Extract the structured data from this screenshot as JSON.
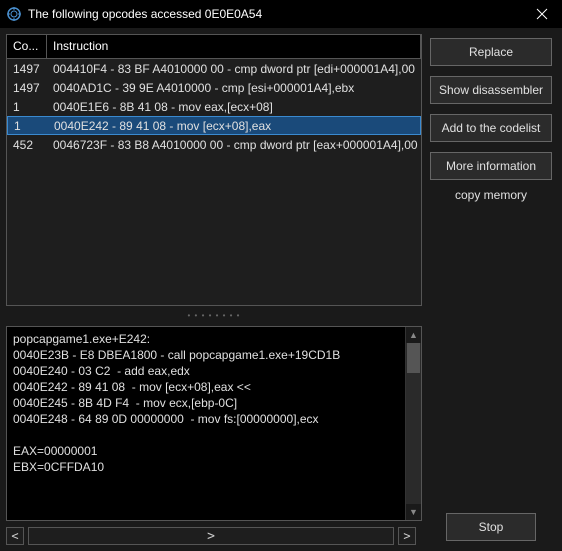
{
  "titlebar": {
    "title": "The following opcodes accessed 0E0E0A54"
  },
  "table": {
    "headers": {
      "count": "Co...",
      "instruction": "Instruction"
    },
    "rows": [
      {
        "count": "1497",
        "instr": "004410F4 - 83 BF A4010000 00 - cmp dword ptr [edi+000001A4],00",
        "selected": false
      },
      {
        "count": "1497",
        "instr": "0040AD1C - 39 9E A4010000  - cmp [esi+000001A4],ebx",
        "selected": false
      },
      {
        "count": "1",
        "instr": "0040E1E6 - 8B 41 08  - mov eax,[ecx+08]",
        "selected": false
      },
      {
        "count": "1",
        "instr": "0040E242 - 89 41 08  - mov [ecx+08],eax",
        "selected": true
      },
      {
        "count": "452",
        "instr": "0046723F - 83 B8 A4010000 00 - cmp dword ptr [eax+000001A4],00",
        "selected": false
      }
    ]
  },
  "detail": {
    "lines": [
      "popcapgame1.exe+E242:",
      "0040E23B - E8 DBEA1800 - call popcapgame1.exe+19CD1B",
      "0040E240 - 03 C2  - add eax,edx",
      "0040E242 - 89 41 08  - mov [ecx+08],eax <<",
      "0040E245 - 8B 4D F4  - mov ecx,[ebp-0C]",
      "0040E248 - 64 89 0D 00000000  - mov fs:[00000000],ecx",
      "",
      "EAX=00000001",
      "EBX=0CFFDA10"
    ]
  },
  "buttons": {
    "replace": "Replace",
    "show_disassembler": "Show disassembler",
    "add_codelist": "Add to the codelist",
    "more_info": "More information",
    "copy_memory": "copy memory",
    "stop": "Stop"
  },
  "nav": {
    "prev": "<",
    "next": ">",
    "main": ">"
  }
}
